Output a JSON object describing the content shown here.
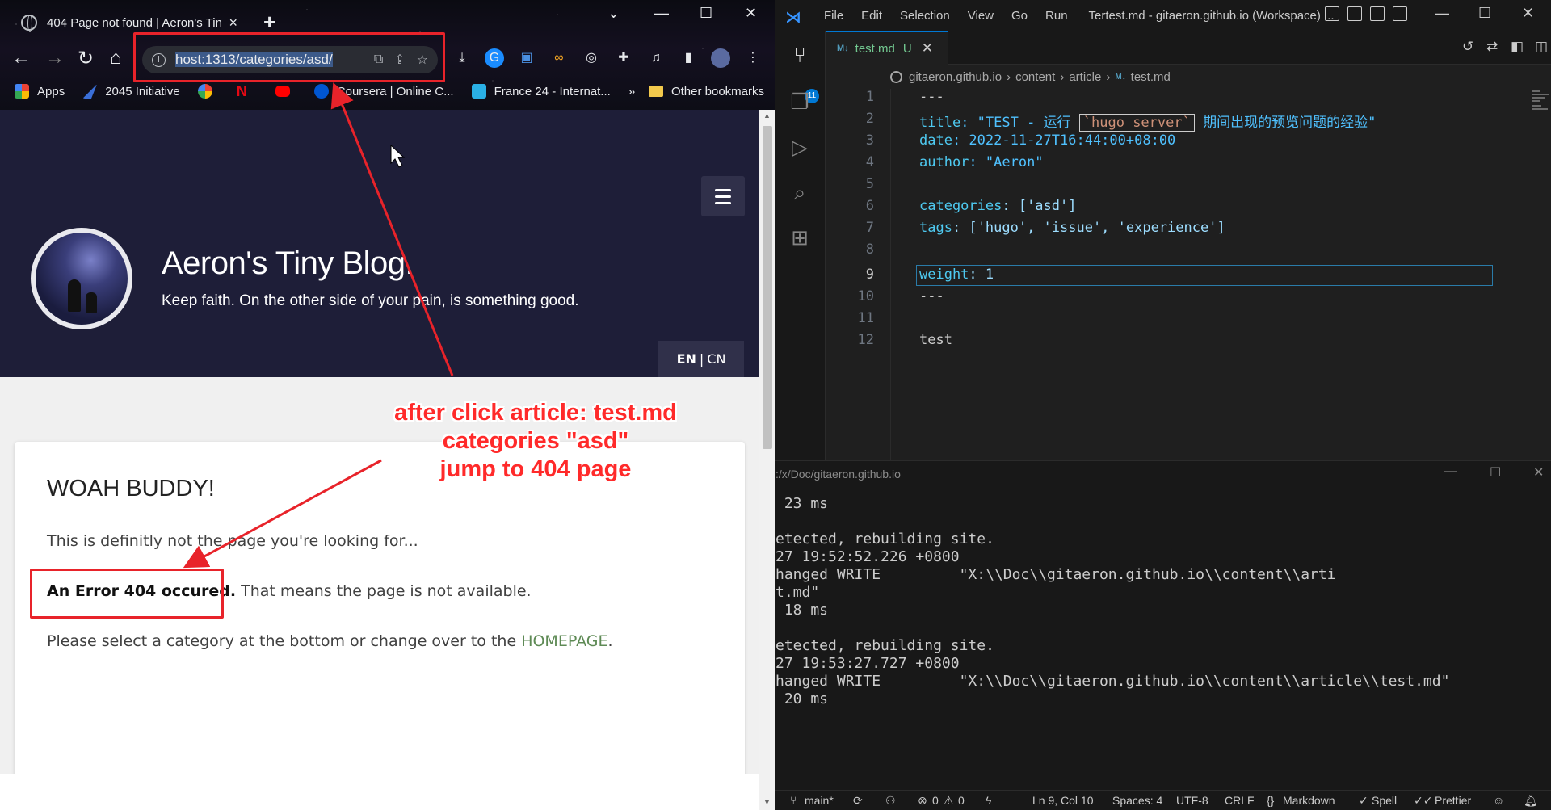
{
  "browser": {
    "tab_title": "404 Page not found | Aeron's Tiny",
    "tab_close": "×",
    "new_tab": "+",
    "omnibox": {
      "url_prefix": "host:1313/categories/asd/",
      "info": "i"
    },
    "bookmarks": [
      {
        "label": "Apps"
      },
      {
        "label": "2045 Initiative"
      },
      {
        "label": "Coursera | Online C..."
      },
      {
        "label": "France 24 - Internat..."
      }
    ],
    "bookmark_overflow": "»",
    "other_bookmarks": "Other bookmarks"
  },
  "site": {
    "title": "Aeron's Tiny Blog.",
    "tagline": "Keep faith. On the other side of your pain, is something good.",
    "lang_en": "EN",
    "lang_sep": "|",
    "lang_cn": "CN"
  },
  "error_page": {
    "heading": "WOAH BUDDY!",
    "line1": "This is definitly not the page you're looking for...",
    "line2_strong": "An Error 404 occured.",
    "line2_rest": " That means the page is not available.",
    "line3_pre": "Please select a category at the bottom or change over to the ",
    "line3_link": "HOMEPAGE",
    "line3_post": "."
  },
  "annotation": {
    "line1": "after click article: test.md",
    "line2": "categories \"asd\"",
    "line3": "jump to 404 page",
    "color": "#e8232a"
  },
  "vscode": {
    "menu": [
      "File",
      "Edit",
      "Selection",
      "View",
      "Go",
      "Run"
    ],
    "window_title": "Tertest.md - gitaeron.github.io (Workspace) ...",
    "tab": {
      "icon": "M↓",
      "name": "test.md",
      "status": "U"
    },
    "breadcrumb": [
      "gitaeron.github.io",
      "content",
      "article",
      "test.md"
    ],
    "activity_badge": "11",
    "editor_lines": [
      {
        "n": "1",
        "text": "---"
      },
      {
        "n": "2",
        "key": "title",
        "pre": ": \"TEST - 运行 ",
        "tick": "`hugo server`",
        "post": " 期间出现的预览问题的经验\""
      },
      {
        "n": "3",
        "key": "date",
        "val": ": 2022-11-27T16:44:00+08:00"
      },
      {
        "n": "4",
        "key": "author",
        "val": ": \"Aeron\""
      },
      {
        "n": "5",
        "text": ""
      },
      {
        "n": "6",
        "key": "categories",
        "val": ": ['asd']"
      },
      {
        "n": "7",
        "key": "tags",
        "val": ": ['hugo', 'issue', 'experience']"
      },
      {
        "n": "8",
        "text": ""
      },
      {
        "n": "9",
        "key": "weight",
        "val": ": 1"
      },
      {
        "n": "10",
        "text": "---"
      },
      {
        "n": "11",
        "text": ""
      },
      {
        "n": "12",
        "text": "test"
      }
    ],
    "panel_path": ":/x/Doc/gitaeron.github.io",
    "terminal": [
      " 23 ms",
      "",
      "etected, rebuilding site.",
      "27 19:52:52.226 +0800",
      "hanged WRITE         \"X:\\\\Doc\\\\gitaeron.github.io\\\\content\\\\arti",
      "t.md\"",
      " 18 ms",
      "",
      "etected, rebuilding site.",
      "27 19:53:27.727 +0800",
      "hanged WRITE         \"X:\\\\Doc\\\\gitaeron.github.io\\\\content\\\\article\\\\test.md\"",
      " 20 ms"
    ],
    "status": {
      "branch": "main*",
      "errors": "0",
      "warnings": "0",
      "position": "Ln 9, Col 10",
      "spaces": "Spaces: 4",
      "encoding": "UTF-8",
      "eol": "CRLF",
      "language": "Markdown",
      "spell": "Spell",
      "prettier": "Prettier"
    }
  }
}
